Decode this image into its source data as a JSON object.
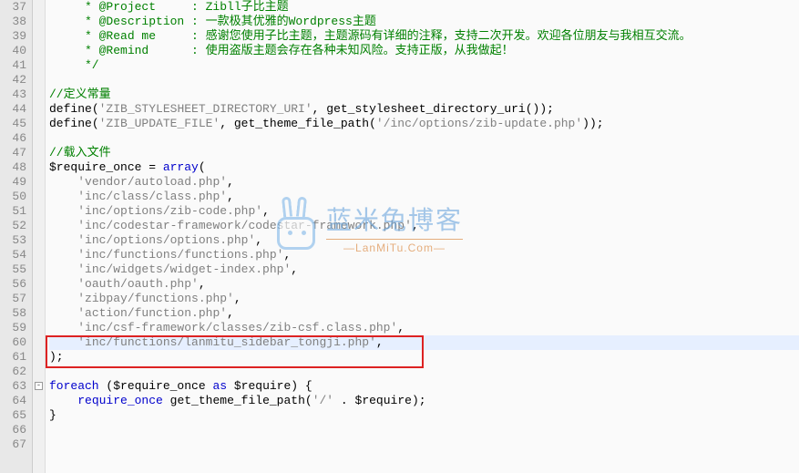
{
  "startLine": 37,
  "endLine": 67,
  "highlightedLine": 60,
  "foldLines": [
    63
  ],
  "watermark": {
    "title": "蓝米兔博客",
    "subtitle": "—LanMiTu.Com—"
  },
  "code": {
    "l37": {
      "indent": "     ",
      "pre": "* @",
      "tag": "Project",
      "spaces": "     ",
      "colon": ": ",
      "text": "Zibll子比主题"
    },
    "l38": {
      "indent": "     ",
      "pre": "* @",
      "tag": "Description",
      "spaces": " ",
      "colon": ": ",
      "text": "一款极其优雅的Wordpress主题"
    },
    "l39": {
      "indent": "     ",
      "pre": "* @",
      "tag": "Read me",
      "spaces": "     ",
      "colon": ": ",
      "text": "感谢您使用子比主题，主题源码有详细的注释，支持二次开发。欢迎各位朋友与我相互交流。"
    },
    "l40": {
      "indent": "     ",
      "pre": "* @",
      "tag": "Remind",
      "spaces": "      ",
      "colon": ": ",
      "text": "使用盗版主题会存在各种未知风险。支持正版，从我做起！"
    },
    "l41": {
      "indent": "     ",
      "text": "*/"
    },
    "l43": {
      "text": "//定义常量"
    },
    "l44": {
      "fn": "define",
      "op": "(",
      "s1": "'ZIB_STYLESHEET_DIRECTORY_URI'",
      "comma": ", ",
      "fn2": "get_stylesheet_directory_uri",
      "tail": "());"
    },
    "l45": {
      "fn": "define",
      "op": "(",
      "s1": "'ZIB_UPDATE_FILE'",
      "comma": ", ",
      "fn2": "get_theme_file_path",
      "op2": "(",
      "s2": "'/inc/options/zib-update.php'",
      "tail": "));"
    },
    "l47": {
      "text": "//载入文件"
    },
    "l48": {
      "var": "$require_once",
      "eq": " = ",
      "kw": "array",
      "tail": "("
    },
    "l49": {
      "indent": "    ",
      "s": "'vendor/autoload.php'",
      "tail": ","
    },
    "l50": {
      "indent": "    ",
      "s": "'inc/class/class.php'",
      "tail": ","
    },
    "l51": {
      "indent": "    ",
      "s": "'inc/options/zib-code.php'",
      "tail": ","
    },
    "l52": {
      "indent": "    ",
      "s": "'inc/codestar-framework/codestar-framework.php'",
      "tail": ","
    },
    "l53": {
      "indent": "    ",
      "s": "'inc/options/options.php'",
      "tail": ","
    },
    "l54": {
      "indent": "    ",
      "s": "'inc/functions/functions.php'",
      "tail": ","
    },
    "l55": {
      "indent": "    ",
      "s": "'inc/widgets/widget-index.php'",
      "tail": ","
    },
    "l56": {
      "indent": "    ",
      "s": "'oauth/oauth.php'",
      "tail": ","
    },
    "l57": {
      "indent": "    ",
      "s": "'zibpay/functions.php'",
      "tail": ","
    },
    "l58": {
      "indent": "    ",
      "s": "'action/function.php'",
      "tail": ","
    },
    "l59": {
      "indent": "    ",
      "s": "'inc/csf-framework/classes/zib-csf.class.php'",
      "tail": ","
    },
    "l60": {
      "indent": "    ",
      "s": "'inc/functions/lanmitu_sidebar_tongji.php'",
      "tail": ","
    },
    "l61": {
      "text": ");"
    },
    "l63": {
      "kw": "foreach",
      "op": " (",
      "var1": "$require_once",
      "as": " as ",
      "var2": "$require",
      "tail": ") {"
    },
    "l64": {
      "indent": "    ",
      "kw": "require_once",
      "sp": " ",
      "fn": "get_theme_file_path",
      "op": "(",
      "s": "'/'",
      "dot": " . ",
      "var": "$require",
      "tail": ");"
    },
    "l65": {
      "text": "}"
    }
  }
}
